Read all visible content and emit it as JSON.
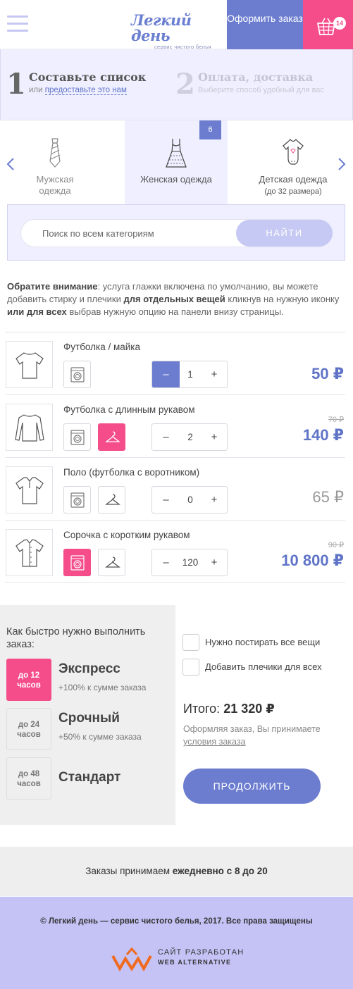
{
  "header": {
    "logo_title": "Легкий день",
    "logo_sub": "сервис чистого белья",
    "order_label": "Оформить заказ",
    "cart_count": "14"
  },
  "steps": [
    {
      "num": "1",
      "title": "Составьте список",
      "sub_prefix": "или ",
      "sub_link": "предоставьте это нам"
    },
    {
      "num": "2",
      "title": "Оплата, доставка",
      "sub": "Выберите способ удобный для вас"
    }
  ],
  "categories": [
    {
      "label": "Мужская одежда",
      "icon": "tie-icon"
    },
    {
      "label": "Женская одежда",
      "icon": "dress-icon",
      "count": "6"
    },
    {
      "label": "Детская одежда",
      "sub": "(до 32 размера)",
      "icon": "onesie-icon"
    }
  ],
  "search": {
    "placeholder": "Поиск по всем категориям",
    "button": "НАЙТИ"
  },
  "notice": {
    "b1": "Обратите внимание",
    "t1": ": услуга глажки включена по умолчанию, вы можете добавить стирку и плечики ",
    "b2": "для отдельных вещей",
    "t2": " кликнув на нужную иконку ",
    "b3": "или для всех",
    "t3": " выбрав нужную опцию на панели внизу страницы."
  },
  "items": [
    {
      "name": "Футболка / майка",
      "qty": "1",
      "price": "50 ₽",
      "old_price": "",
      "wash_active": false,
      "hanger_active": false,
      "minus_active": true
    },
    {
      "name": "Футболка с длинным рукавом",
      "qty": "2",
      "price": "140 ₽",
      "old_price": "70 ₽",
      "wash_active": false,
      "hanger_active": true,
      "minus_active": false
    },
    {
      "name": "Поло (футболка с воротником)",
      "qty": "0",
      "price": "65 ₽",
      "old_price": "",
      "wash_active": false,
      "hanger_active": false,
      "minus_active": false
    },
    {
      "name": "Сорочка с коротким рукавом",
      "qty": "120",
      "price": "10 800 ₽",
      "old_price": "90 ₽",
      "wash_active": true,
      "hanger_active": false,
      "minus_active": false
    }
  ],
  "speed": {
    "title": "Как быстро нужно выполнить заказ:",
    "options": [
      {
        "box_line1": "до 12",
        "box_line2": "часов",
        "name": "Экспресс",
        "desc": "+100% к сумме заказа",
        "active": true
      },
      {
        "box_line1": "до 24",
        "box_line2": "часов",
        "name": "Срочный",
        "desc": "+50% к сумме заказа",
        "active": false
      },
      {
        "box_line1": "до 48",
        "box_line2": "часов",
        "name": "Стандарт",
        "desc": "",
        "active": false
      }
    ]
  },
  "summary": {
    "check1": "Нужно постирать все вещи",
    "check2": "Добавить плечики для всех",
    "total_label": "Итого: ",
    "total_value": "21 320 ₽",
    "terms_text": "Оформляя заказ, Вы принимаете ",
    "terms_link": "условия заказа",
    "continue": "ПРОДОЛЖИТЬ"
  },
  "hours": {
    "prefix": "Заказы  принимаем ",
    "bold": "ежедневно с 8 до 20"
  },
  "footer": {
    "copyright": "© Легкий день — сервис чистого белья, 2017. Все права защищены",
    "dev_line1": "САЙТ РАЗРАБОТАН",
    "dev_line2": "WEB ALTERNATIVE"
  },
  "colors": {
    "accent": "#6c7dd0",
    "pink": "#f44d8a",
    "lavender": "#efefff"
  }
}
